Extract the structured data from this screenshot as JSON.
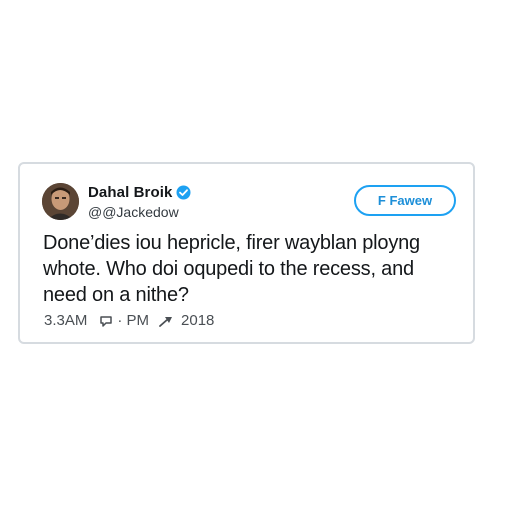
{
  "tweet": {
    "display_name": "Dahal Broik",
    "handle": "@@Jackedow",
    "verified": true,
    "follow_label": "F Fawew",
    "text": "Done’dies iou hepricle, firer wayblan ployng whote. Who doi oqupedi to the recess, and need on a nithe?",
    "meta": {
      "time": "3.3AM",
      "pm": "· PM",
      "year": "2018"
    }
  },
  "colors": {
    "accent": "#1da1f2",
    "card_border": "#d6dbe0",
    "text": "#14171a"
  },
  "icons": {
    "verified": "verified-badge-icon",
    "reply": "reply-icon",
    "share": "share-icon"
  }
}
